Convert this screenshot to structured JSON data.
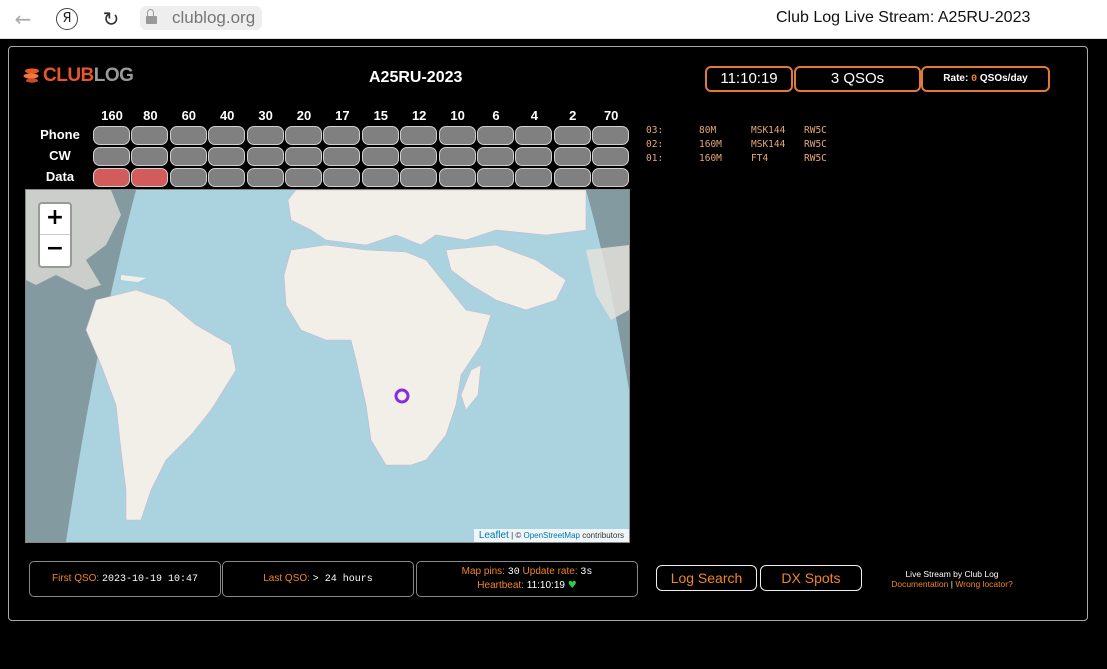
{
  "browser": {
    "url": "clublog.org",
    "tab_title": "Club Log Live Stream: A25RU-2023",
    "ya_glyph": "Я",
    "back_glyph": "←",
    "reload_glyph": "↻"
  },
  "header": {
    "logo_text_a": "CLUB",
    "logo_text_b": "LOG",
    "callsign_title": "A25RU-2023",
    "clock": "11:10:19",
    "qso_count": "3 QSOs",
    "rate_label": "Rate: ",
    "rate_value": "0",
    "rate_unit": " QSOs/day"
  },
  "bands": [
    "160",
    "80",
    "60",
    "40",
    "30",
    "20",
    "17",
    "15",
    "12",
    "10",
    "6",
    "4",
    "2",
    "70"
  ],
  "modes": [
    "Phone",
    "CW",
    "Data"
  ],
  "band_matrix_active": {
    "Phone": [],
    "CW": [],
    "Data": [
      "160",
      "80"
    ]
  },
  "colors": {
    "accent_orange": "#f0852a",
    "cell_inactive": "#808080",
    "cell_active": "#d25b5b",
    "qso_text": "#e5a77a",
    "map_marker": "#8a2be2"
  },
  "map": {
    "zoom_in": "+",
    "zoom_out": "−",
    "attrib_leaflet": "Leaflet",
    "attrib_sep": " | © ",
    "attrib_osm": "OpenStreetMap",
    "attrib_tail": " contributors"
  },
  "qsos": [
    {
      "n": "03:",
      "band": "80M",
      "mode": "MSK144",
      "call": "RW5C"
    },
    {
      "n": "02:",
      "band": "160M",
      "mode": "MSK144",
      "call": "RW5C"
    },
    {
      "n": "01:",
      "band": "160M",
      "mode": "FT4",
      "call": "RW5C"
    }
  ],
  "stats": {
    "first_qso_label": "First QSO: ",
    "first_qso_value": "2023-10-19 10:47",
    "last_qso_label": "Last QSO: ",
    "last_qso_value": "> 24 hours",
    "map_pins_label": "Map pins: ",
    "map_pins_value": "30",
    "update_rate_label": " Update rate: ",
    "update_rate_value": "3s",
    "heartbeat_label": "Heartbeat: ",
    "heartbeat_value": "11:10:19",
    "heart_glyph": "♥"
  },
  "buttons": {
    "log_search": "Log Search",
    "dx_spots": "DX Spots"
  },
  "footer": {
    "credit": "Live Stream by Club Log",
    "doc_link": "Documentation",
    "sep": " | ",
    "wrong_locator": "Wrong locator?"
  }
}
